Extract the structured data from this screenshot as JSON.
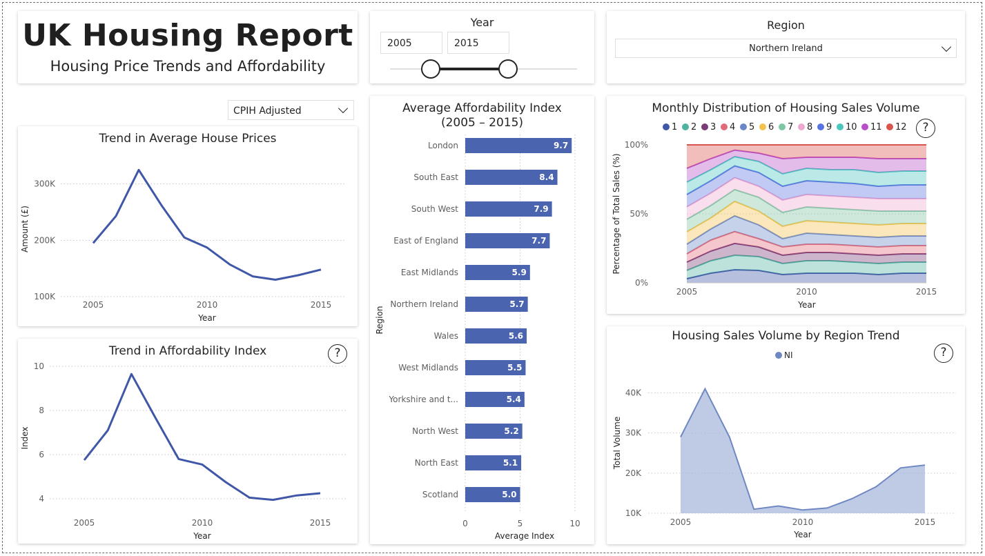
{
  "header": {
    "title": "UK Housing Report",
    "subtitle": "Housing Price Trends and Affordability"
  },
  "year_slicer": {
    "label": "Year",
    "start": "2005",
    "end": "2015",
    "range_min": 2005,
    "range_max": 2015,
    "selected_start": 2005,
    "selected_end": 2015
  },
  "region_slicer": {
    "label": "Region",
    "selected": "Northern Ireland"
  },
  "adjustment_dropdown": {
    "selected": "CPIH Adjusted"
  },
  "colors": {
    "primary": "#3f57a6",
    "bar": "#4a64b0",
    "ni_area": "#a9b8dc",
    "ni_line": "#6f87c2"
  },
  "chart_data": [
    {
      "id": "house_prices",
      "type": "line",
      "title": "Trend in Average House Prices",
      "xlabel": "Year",
      "ylabel": "Amount (£)",
      "x": [
        2005,
        2006,
        2007,
        2008,
        2009,
        2010,
        2011,
        2012,
        2013,
        2014,
        2015
      ],
      "values": [
        195000,
        243000,
        325000,
        262000,
        205000,
        187000,
        157000,
        136000,
        130000,
        138000,
        148000
      ],
      "ylim": [
        100000,
        340000
      ],
      "yticks": [
        {
          "v": 100000,
          "label": "100K"
        },
        {
          "v": 200000,
          "label": "200K"
        },
        {
          "v": 300000,
          "label": "300K"
        }
      ],
      "xticks": [
        {
          "v": 2005,
          "label": "2005"
        },
        {
          "v": 2010,
          "label": "2010"
        },
        {
          "v": 2015,
          "label": "2015"
        }
      ],
      "grid": true
    },
    {
      "id": "affordability_trend",
      "type": "line",
      "title": "Trend in Affordability Index",
      "xlabel": "Year",
      "ylabel": "Index",
      "help": "?",
      "x": [
        2005,
        2006,
        2007,
        2008,
        2009,
        2010,
        2011,
        2012,
        2013,
        2014,
        2015
      ],
      "values": [
        5.75,
        7.1,
        9.65,
        7.7,
        5.8,
        5.55,
        4.75,
        4.05,
        3.95,
        4.15,
        4.25
      ],
      "ylim": [
        3.5,
        10
      ],
      "yticks": [
        {
          "v": 4,
          "label": "4"
        },
        {
          "v": 6,
          "label": "6"
        },
        {
          "v": 8,
          "label": "8"
        },
        {
          "v": 10,
          "label": "10"
        }
      ],
      "xticks": [
        {
          "v": 2005,
          "label": "2005"
        },
        {
          "v": 2010,
          "label": "2010"
        },
        {
          "v": 2015,
          "label": "2015"
        }
      ],
      "grid": true
    },
    {
      "id": "affordability_by_region",
      "type": "bar",
      "orientation": "horizontal",
      "title": "Average Affordability Index",
      "subtitle": "(2005 – 2015)",
      "xlabel": "Average Index",
      "ylabel": "Region",
      "categories": [
        "London",
        "South East",
        "South West",
        "East of England",
        "East Midlands",
        "Northern Ireland",
        "Wales",
        "West Midlands",
        "Yorkshire and t...",
        "North West",
        "North East",
        "Scotland"
      ],
      "values": [
        9.7,
        8.4,
        7.9,
        7.7,
        5.9,
        5.7,
        5.6,
        5.5,
        5.4,
        5.2,
        5.1,
        5.0
      ],
      "data_labels": [
        "9.7",
        "8.4",
        "7.9",
        "7.7",
        "5.9",
        "5.7",
        "5.6",
        "5.5",
        "5.4",
        "5.2",
        "5.1",
        "5.0"
      ],
      "xlim": [
        0,
        10
      ],
      "xticks": [
        {
          "v": 0,
          "label": "0"
        },
        {
          "v": 5,
          "label": "5"
        },
        {
          "v": 10,
          "label": "10"
        }
      ],
      "grid": true
    },
    {
      "id": "monthly_distribution",
      "type": "area",
      "stacked": "percent",
      "title": "Monthly Distribution of Housing Sales Volume",
      "xlabel": "Year",
      "ylabel": "Percentage of Total Sales (%)",
      "help": "?",
      "legend_position": "top",
      "x": [
        2005,
        2006,
        2007,
        2008,
        2009,
        2010,
        2011,
        2012,
        2013,
        2014,
        2015
      ],
      "series": [
        {
          "name": "1",
          "color": "#3f57a6",
          "values": [
            3,
            7,
            10,
            9,
            6,
            7,
            7,
            7,
            6,
            7,
            7
          ]
        },
        {
          "name": "2",
          "color": "#4fb3a0",
          "values": [
            6,
            9,
            11,
            10,
            8,
            9,
            9,
            8,
            8,
            8,
            8
          ]
        },
        {
          "name": "3",
          "color": "#7b3d78",
          "values": [
            6,
            7,
            9,
            7,
            6,
            6,
            6,
            6,
            6,
            6,
            6
          ]
        },
        {
          "name": "4",
          "color": "#e06b7a",
          "values": [
            6,
            8,
            9,
            6,
            6,
            6,
            6,
            6,
            6,
            6,
            6
          ]
        },
        {
          "name": "5",
          "color": "#6a86c9",
          "values": [
            7,
            8,
            12,
            10,
            6,
            8,
            7,
            7,
            7,
            7,
            7
          ]
        },
        {
          "name": "6",
          "color": "#f2c24f",
          "values": [
            9,
            8,
            11,
            10,
            9,
            9,
            9,
            9,
            9,
            9,
            9
          ]
        },
        {
          "name": "7",
          "color": "#7fc6a4",
          "values": [
            9,
            9,
            9,
            10,
            10,
            10,
            10,
            10,
            10,
            9,
            9
          ]
        },
        {
          "name": "8",
          "color": "#efa8cf",
          "values": [
            9,
            9,
            9,
            8,
            9,
            9,
            9,
            9,
            9,
            9,
            9
          ]
        },
        {
          "name": "9",
          "color": "#5a73e0",
          "values": [
            9,
            9,
            9,
            10,
            10,
            10,
            10,
            10,
            9,
            10,
            10
          ]
        },
        {
          "name": "10",
          "color": "#4cc5bf",
          "values": [
            9,
            8,
            7,
            8,
            9,
            9,
            9,
            10,
            10,
            10,
            10
          ]
        },
        {
          "name": "11",
          "color": "#b94fc9",
          "values": [
            10,
            8,
            5,
            6,
            11,
            8,
            9,
            9,
            10,
            9,
            9
          ]
        },
        {
          "name": "12",
          "color": "#d9534f",
          "values": [
            17,
            10,
            4,
            6,
            10,
            9,
            9,
            9,
            10,
            10,
            10
          ]
        }
      ],
      "ylim": [
        0,
        100
      ],
      "yticks": [
        {
          "v": 0,
          "label": "0%"
        },
        {
          "v": 50,
          "label": "50%"
        },
        {
          "v": 100,
          "label": "100%"
        }
      ],
      "xticks": [
        {
          "v": 2005,
          "label": "2005"
        },
        {
          "v": 2010,
          "label": "2010"
        },
        {
          "v": 2015,
          "label": "2015"
        }
      ],
      "grid": true
    },
    {
      "id": "sales_volume_region",
      "type": "area",
      "title": "Housing Sales Volume by Region Trend",
      "xlabel": "Year",
      "ylabel": "Total Volume",
      "help": "?",
      "legend_position": "top",
      "x": [
        2005,
        2006,
        2007,
        2008,
        2009,
        2010,
        2011,
        2012,
        2013,
        2014,
        2015
      ],
      "series": [
        {
          "name": "NI",
          "values": [
            29000,
            41000,
            29000,
            11000,
            11800,
            10800,
            11300,
            13600,
            16600,
            21300,
            22000
          ]
        }
      ],
      "ylim": [
        10000,
        43000
      ],
      "yticks": [
        {
          "v": 10000,
          "label": "10K"
        },
        {
          "v": 20000,
          "label": "20K"
        },
        {
          "v": 30000,
          "label": "30K"
        },
        {
          "v": 40000,
          "label": "40K"
        }
      ],
      "xticks": [
        {
          "v": 2005,
          "label": "2005"
        },
        {
          "v": 2010,
          "label": "2010"
        },
        {
          "v": 2015,
          "label": "2015"
        }
      ],
      "grid": true
    }
  ]
}
